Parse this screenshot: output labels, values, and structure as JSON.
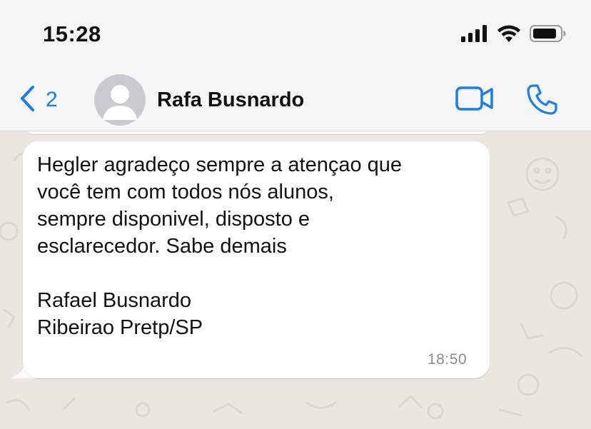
{
  "status_bar": {
    "time": "15:28",
    "icons": [
      "cellular-signal-icon",
      "wifi-icon",
      "battery-icon"
    ]
  },
  "header": {
    "back_count": "2",
    "contact_name": "Rafa Busnardo",
    "icons": [
      "chevron-left-icon",
      "avatar-placeholder-icon",
      "video-camera-icon",
      "phone-icon"
    ]
  },
  "message": {
    "text": "Hegler agradeço sempre a atençao que\nvocê tem com todos nós alunos,\nsempre disponivel, disposto e\nesclarecedor. Sabe demais\n\nRafael Busnardo\nRibeirao Pretp/SP",
    "time": "18:50"
  },
  "colors": {
    "accent": "#1a7fe6",
    "header_bg": "#f6f6f6",
    "chat_bg": "#ebe6df",
    "bubble_bg": "#ffffff",
    "time_text": "#8c8c8c"
  }
}
